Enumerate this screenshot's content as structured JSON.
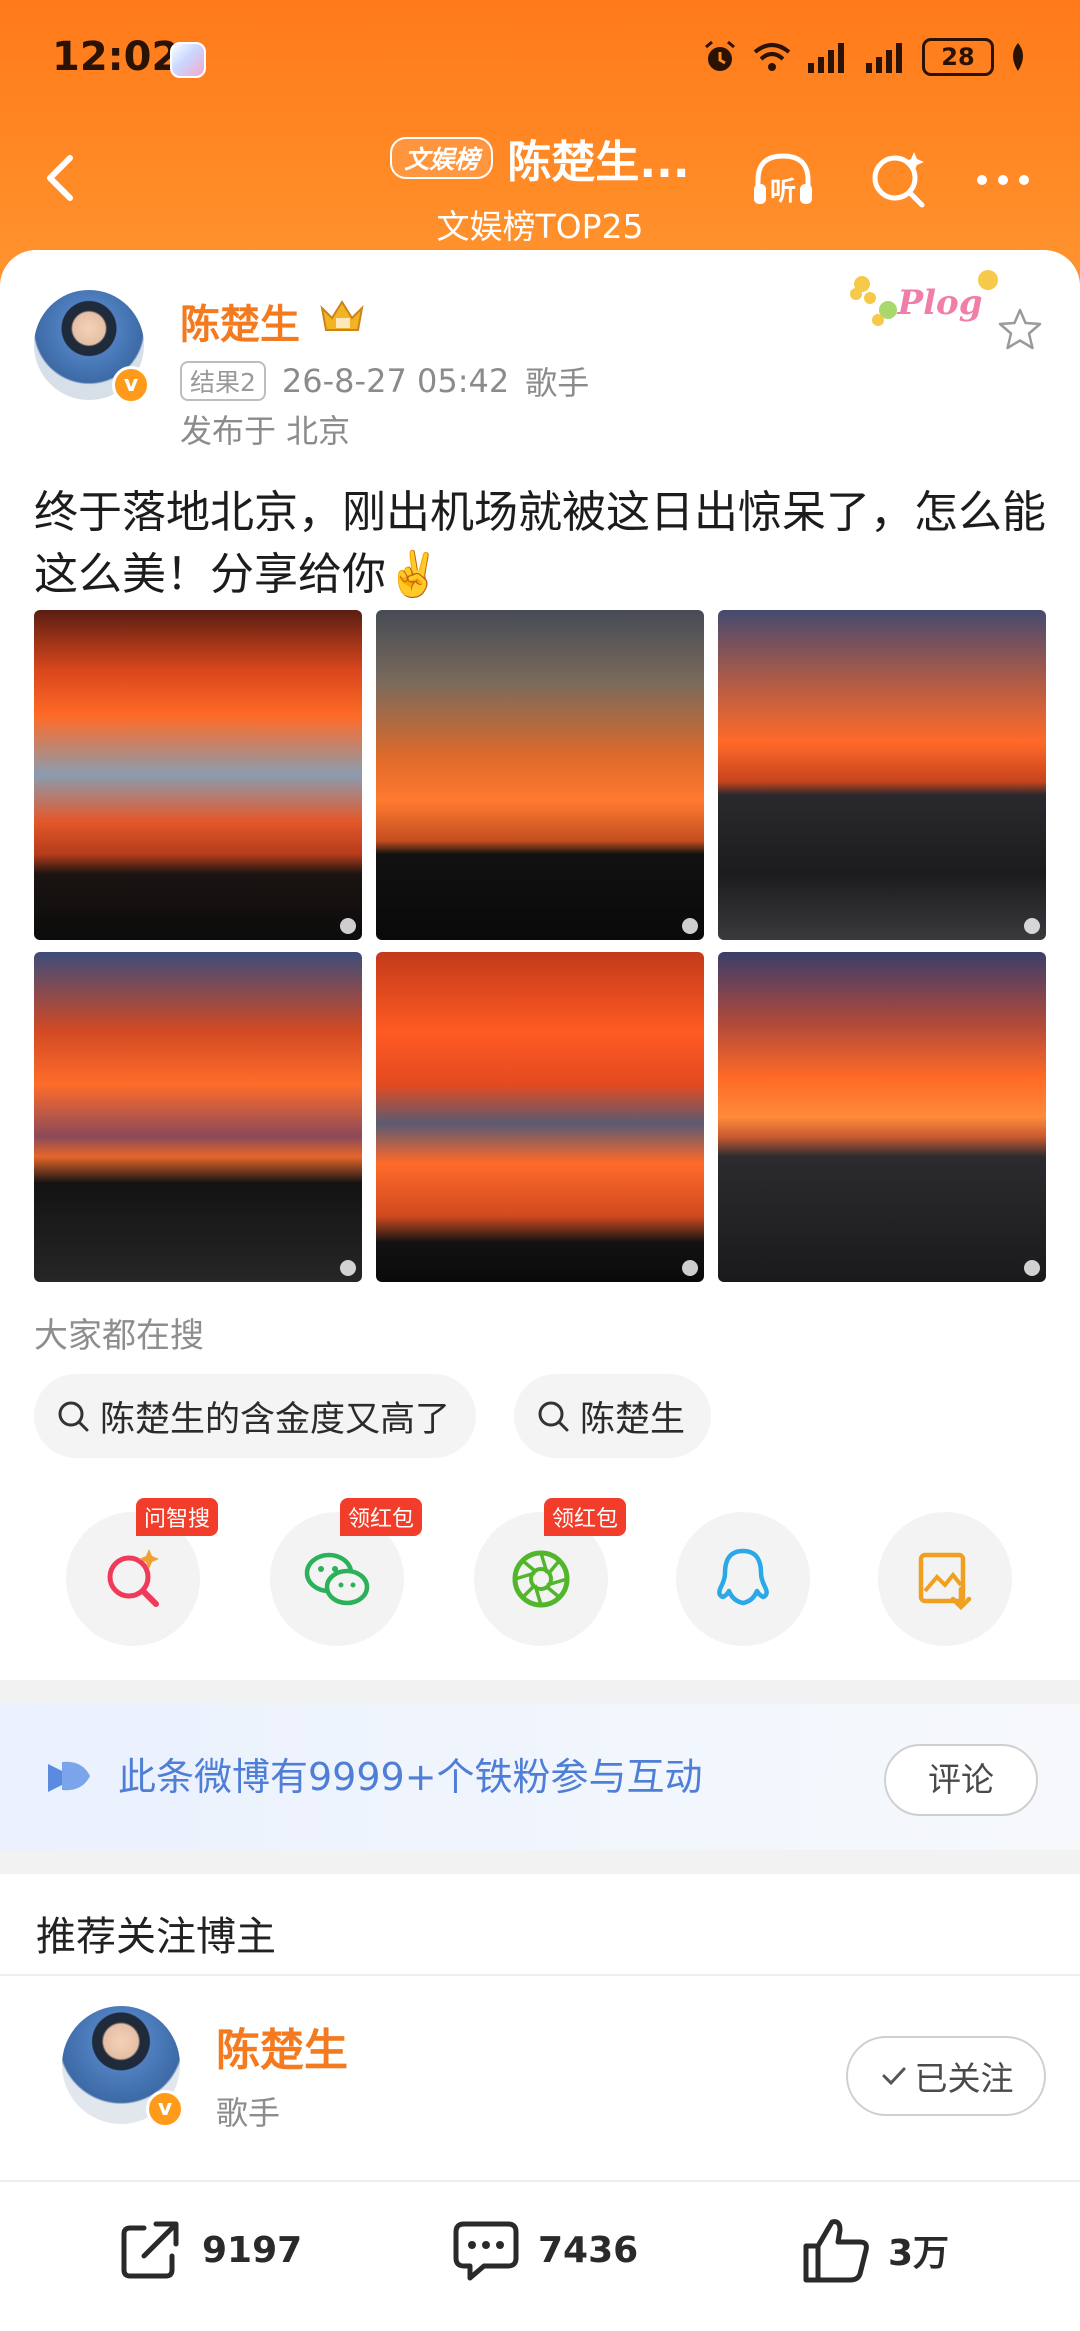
{
  "status_bar": {
    "time": "12:02",
    "battery": "28"
  },
  "nav": {
    "tag": "文娱榜",
    "title": "陈楚生...",
    "subtitle": "文娱榜TOP25",
    "listen_label": "听"
  },
  "post": {
    "author": "陈楚生",
    "result_tag": "结果2",
    "datetime": "26-8-27 05:42",
    "role": "歌手",
    "location": "发布于 北京",
    "text": "终于落地北京，刚出机场就被这日出惊呆了，怎么能这么美！分享给你✌️",
    "plog_label": "Plog"
  },
  "search": {
    "title": "大家都在搜",
    "chips": [
      "陈楚生的含金度又高了",
      "陈楚生"
    ]
  },
  "share": {
    "badges": [
      "问智搜",
      "领红包",
      "领红包"
    ]
  },
  "fans_banner": {
    "text": "此条微博有9999+个铁粉参与互动",
    "button": "评论"
  },
  "recommend": {
    "title": "推荐关注博主",
    "name": "陈楚生",
    "desc": "歌手",
    "follow_label": "已关注"
  },
  "actions": {
    "reposts": "9197",
    "comments": "7436",
    "likes": "3万"
  },
  "colors": {
    "accent": "#ff7a1a",
    "username": "#f47a20",
    "link_blue": "#4f7ed6"
  }
}
